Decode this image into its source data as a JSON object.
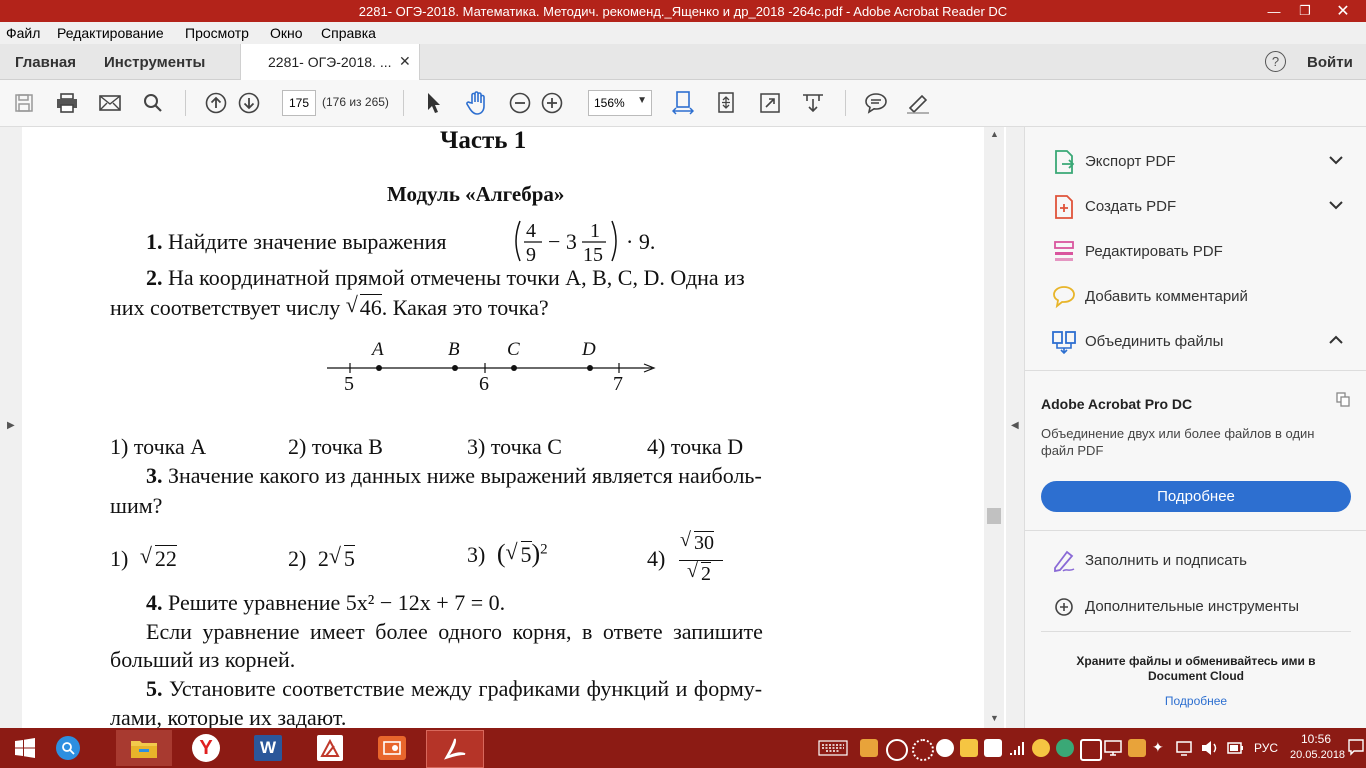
{
  "window": {
    "title": "2281- ОГЭ-2018. Математика. Методич. рекоменд._Ященко и др_2018 -264с.pdf - Adobe Acrobat Reader DC"
  },
  "menu": [
    "Файл",
    "Редактирование",
    "Просмотр",
    "Окно",
    "Справка"
  ],
  "tabs": {
    "home": "Главная",
    "tools": "Инструменты",
    "document": "2281- ОГЭ-2018. ...",
    "help_icon": "?",
    "login": "Войти"
  },
  "toolbar": {
    "page_current": "175",
    "page_count": "(176 из 265)",
    "zoom": "156%"
  },
  "document": {
    "part_title": "Часть 1",
    "module_title": "Модуль «Алгебра»",
    "q1": {
      "num": "1.",
      "text": "Найдите значение выражения",
      "expr_end": "· 9."
    },
    "q2": {
      "num": "2.",
      "line1": "На координатной прямой отмечены точки A, B, C, D. Одна из",
      "line2_a": "них соответствует числу",
      "radicand": "46",
      "line2_b": ". Какая это точка?"
    },
    "numberline": {
      "points": [
        "A",
        "B",
        "C",
        "D"
      ],
      "ticks": [
        "5",
        "6",
        "7"
      ]
    },
    "q2_answers": [
      "1) точка A",
      "2) точка B",
      "3) точка C",
      "4) точка D"
    ],
    "q3": {
      "num": "3.",
      "line1": "Значение какого из данных ниже выражений является наиболь-",
      "line2": "шим?"
    },
    "q3_answers": {
      "a1_label": "1)",
      "a1_rad": "22",
      "a2_label": "2)",
      "a2_coef": "2",
      "a2_rad": "5",
      "a3_label": "3)",
      "a3_rad": "5",
      "a3_exp": "2",
      "a4_label": "4)",
      "a4_num": "30",
      "a4_den": "2"
    },
    "q4": {
      "num": "4.",
      "text": "Решите уравнение 5x² − 12x + 7 = 0.",
      "line2": "Если уравнение имеет более одного корня, в ответе запишите",
      "line3": "больший из корней."
    },
    "q5": {
      "num": "5.",
      "line1": "Установите соответствие между графиками функций и форму-",
      "line2": "лами, которые их задают."
    }
  },
  "right_panel": {
    "tools": [
      {
        "label": "Экспорт PDF",
        "icon": "export-pdf-icon"
      },
      {
        "label": "Создать PDF",
        "icon": "create-pdf-icon"
      },
      {
        "label": "Редактировать PDF",
        "icon": "edit-pdf-icon"
      },
      {
        "label": "Добавить комментарий",
        "icon": "comment-icon"
      },
      {
        "label": "Объединить файлы",
        "icon": "combine-files-icon"
      }
    ],
    "promo_title": "Adobe Acrobat Pro DC",
    "promo_text1": "Объединение двух или более файлов в один",
    "promo_text2": "файл PDF",
    "promo_button": "Подробнее",
    "fill_sign": "Заполнить и подписать",
    "more_tools": "Дополнительные инструменты",
    "cloud_text1": "Храните файлы и обменивайтесь ими в",
    "cloud_text2": "Document Cloud",
    "cloud_link": "Подробнее"
  },
  "taskbar": {
    "lang": "РУС",
    "time": "10:56",
    "date": "20.05.2018"
  },
  "colors": {
    "titlebar": "#b3231a",
    "taskbar": "#8c1b14",
    "accent_blue": "#2d6fd0"
  }
}
